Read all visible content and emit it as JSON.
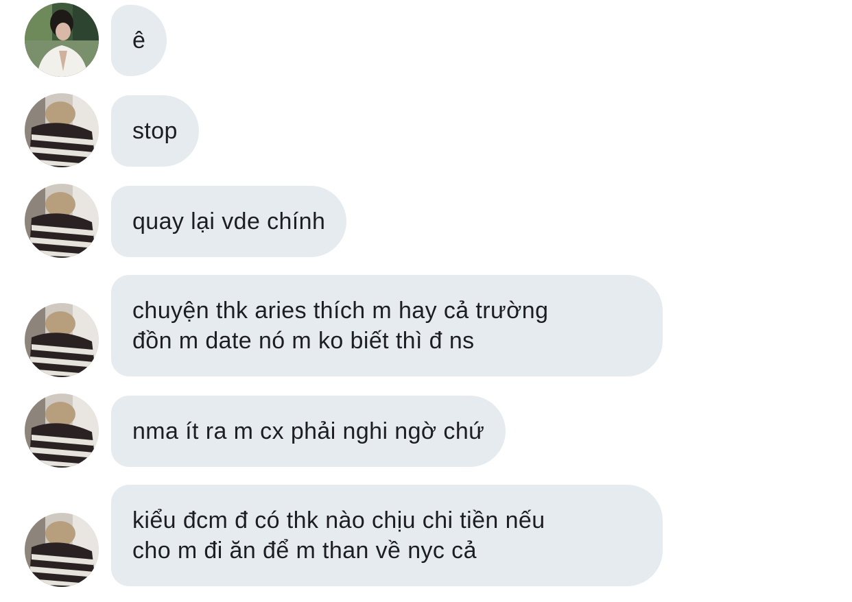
{
  "conversation": {
    "messages": [
      {
        "sender_avatar": "garden-photo-avatar",
        "text": "ê"
      },
      {
        "sender_avatar": "striped-sweater-avatar",
        "text": "stop"
      },
      {
        "sender_avatar": "striped-sweater-avatar",
        "text": "quay lại vde chính"
      },
      {
        "sender_avatar": "striped-sweater-avatar",
        "text": "chuyện thk aries thích m hay cả trường\nđồn m date nó m ko biết thì đ ns"
      },
      {
        "sender_avatar": "striped-sweater-avatar",
        "text": "nma ít ra m cx phải nghi ngờ chứ"
      },
      {
        "sender_avatar": "striped-sweater-avatar",
        "text": "kiểu đcm đ có thk nào chịu chi tiền nếu\ncho m đi ăn để m than về nyc cả"
      }
    ]
  },
  "colors": {
    "bubble_background": "#e6ebf0",
    "text": "#1c1e21",
    "page_background": "#ffffff"
  }
}
